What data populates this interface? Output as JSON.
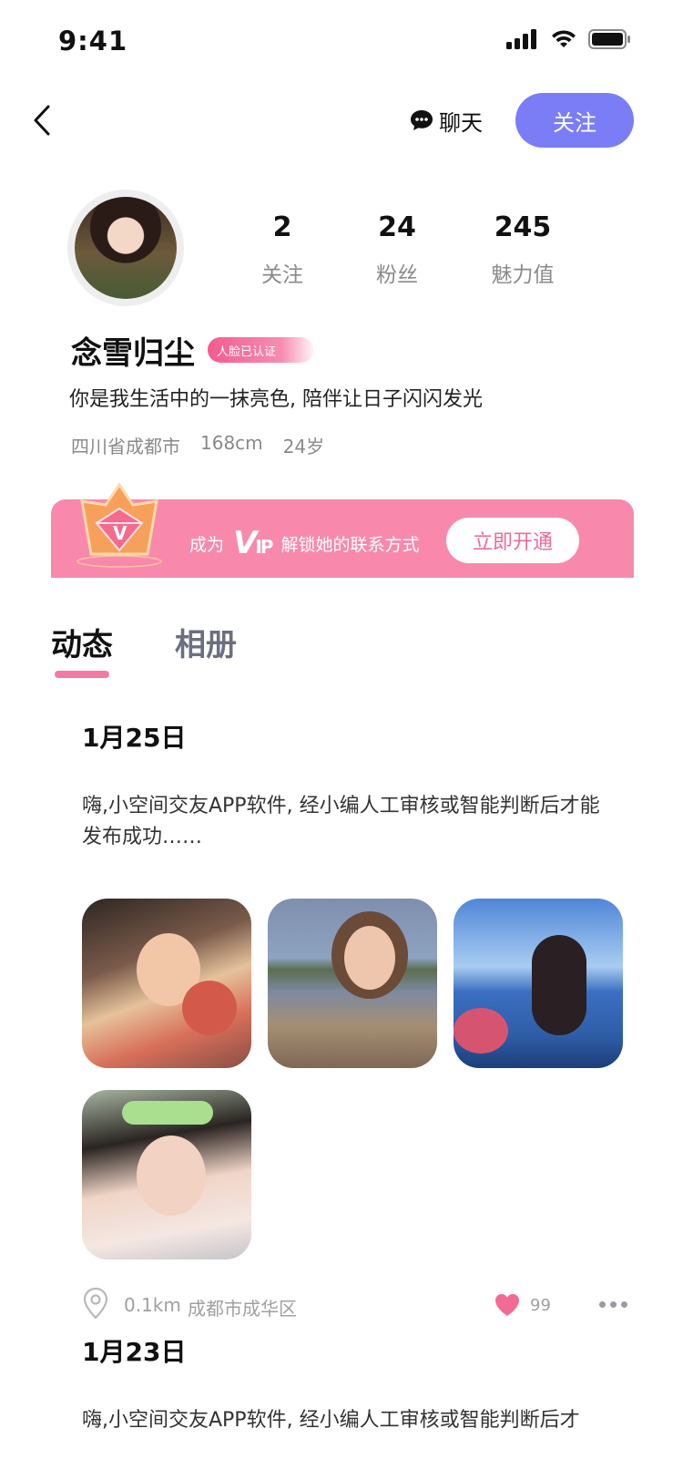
{
  "status_bar": {
    "time": "9:41"
  },
  "nav": {
    "chat_label": "聊天",
    "follow_label": "关注"
  },
  "profile": {
    "stats": [
      {
        "value": "2",
        "label": "关注"
      },
      {
        "value": "24",
        "label": "粉丝"
      },
      {
        "value": "245",
        "label": "魅力值"
      }
    ],
    "name": "念雪归尘",
    "verify_badge": "人脸已认证",
    "bio": "你是我生活中的一抹亮色, 陪伴让日子闪闪发光",
    "location": "四川省成都市",
    "height": "168cm",
    "age": "24岁"
  },
  "vip_banner": {
    "prefix": "成为",
    "logo_v": "V",
    "logo_ip": "IP",
    "suffix": "解锁她的联系方式",
    "button": "立即开通"
  },
  "tabs": [
    {
      "label": "动态",
      "active": true
    },
    {
      "label": "相册",
      "active": false
    }
  ],
  "posts": [
    {
      "date": "1月25日",
      "text": "嗨,小空间交友APP软件, 经小编人工审核或智能判断后才能发布成功……",
      "photo_count": 4,
      "distance": "0.1km",
      "district": "成都市成华区",
      "likes": "99"
    },
    {
      "date": "1月23日",
      "text": "嗨,小空间交友APP软件, 经小编人工审核或智能判断后才"
    }
  ],
  "colors": {
    "accent_purple": "#7b7df7",
    "accent_pink": "#f37ba2",
    "vip_banner": "#f889ad"
  }
}
